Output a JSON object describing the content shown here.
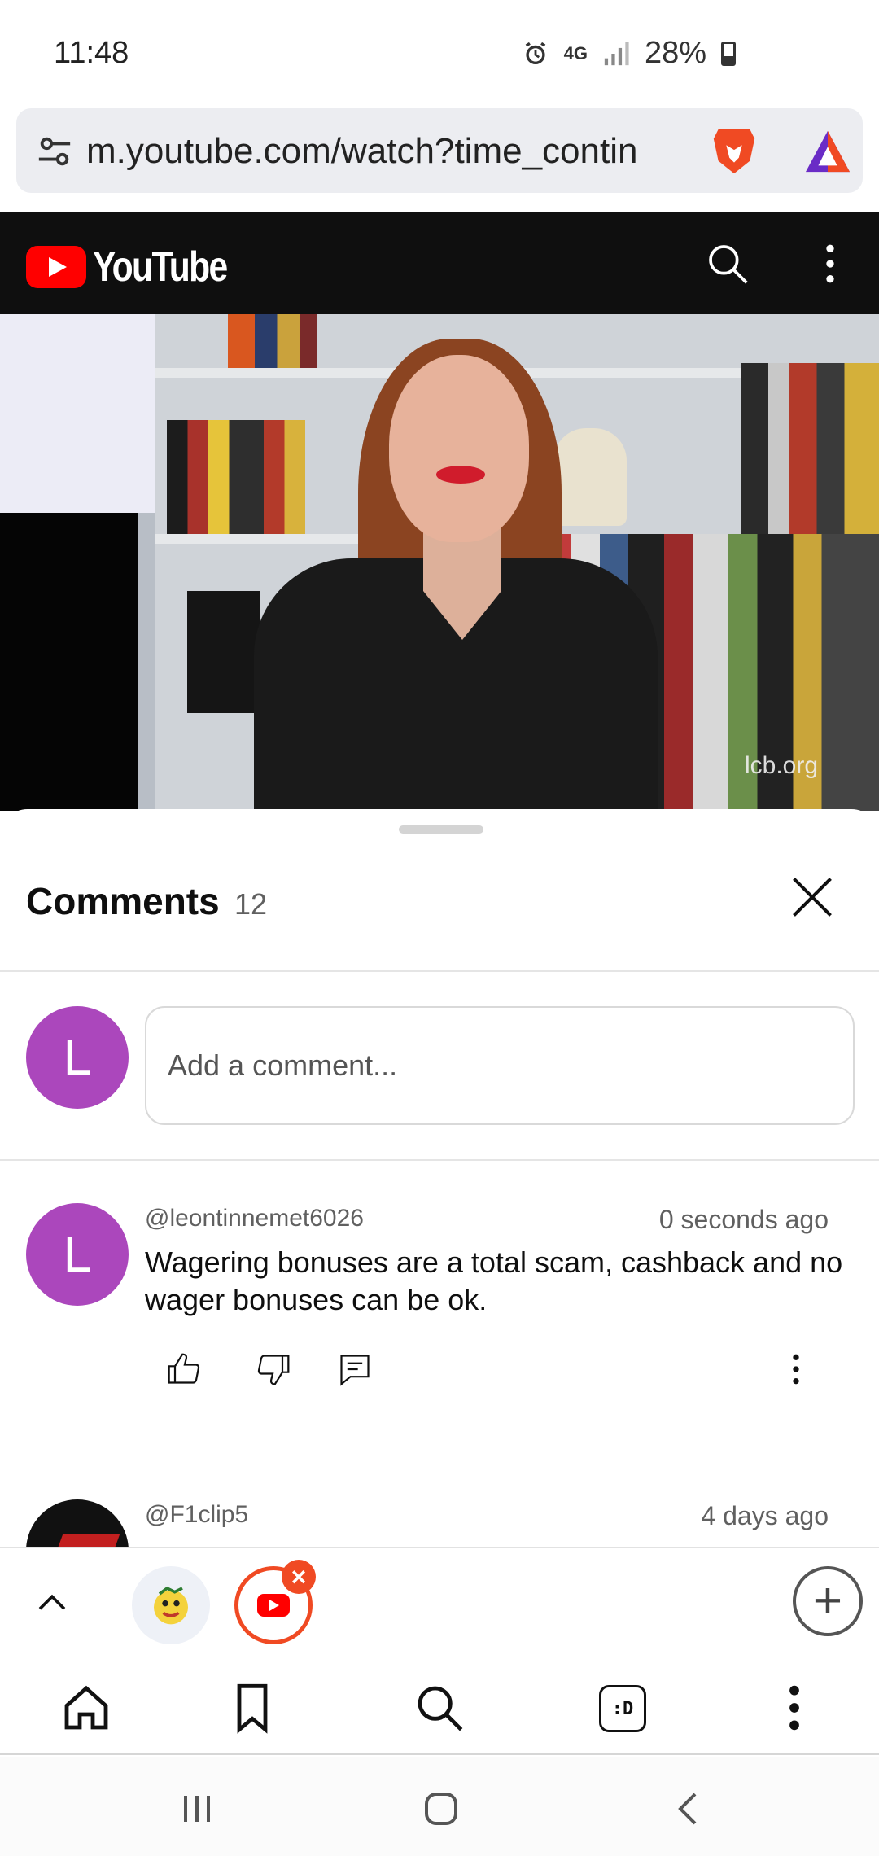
{
  "status_bar": {
    "time": "11:48",
    "network": "4G",
    "battery": "28%"
  },
  "browser": {
    "url": "m.youtube.com/watch?time_contin",
    "icons": [
      "tune-icon",
      "brave-shields-icon",
      "brave-rewards-icon"
    ]
  },
  "youtube_header": {
    "logo_text": "YouTube",
    "icons": [
      "search-icon",
      "more-vert-icon"
    ]
  },
  "video": {
    "watermark": "lcb.org"
  },
  "comments_panel": {
    "title": "Comments",
    "count": "12",
    "input_avatar_letter": "L",
    "input_placeholder": "Add a comment...",
    "comments": [
      {
        "avatar_letter": "L",
        "author": "@leontinnemet6026",
        "time": "0 seconds ago",
        "text": "Wagering bonuses are a total scam, cashback and no wager bonuses can be ok."
      },
      {
        "author": "@F1clip5",
        "time": "4 days ago"
      }
    ]
  },
  "tab_strip": {
    "tab_icons": [
      "lcb-favicon",
      "youtube-favicon"
    ],
    "close_label": "×",
    "new_tab_label": "+"
  },
  "bottom_nav": {
    "items": [
      "home-icon",
      "bookmark-icon",
      "search-icon",
      "playlist-icon",
      "more-vert-icon"
    ],
    "playlist_label": ":D"
  },
  "colors": {
    "youtube_red": "#ff0000",
    "brave_orange": "#f04a23",
    "avatar_purple": "#ab47bc",
    "header_black": "#0f0f0f"
  }
}
